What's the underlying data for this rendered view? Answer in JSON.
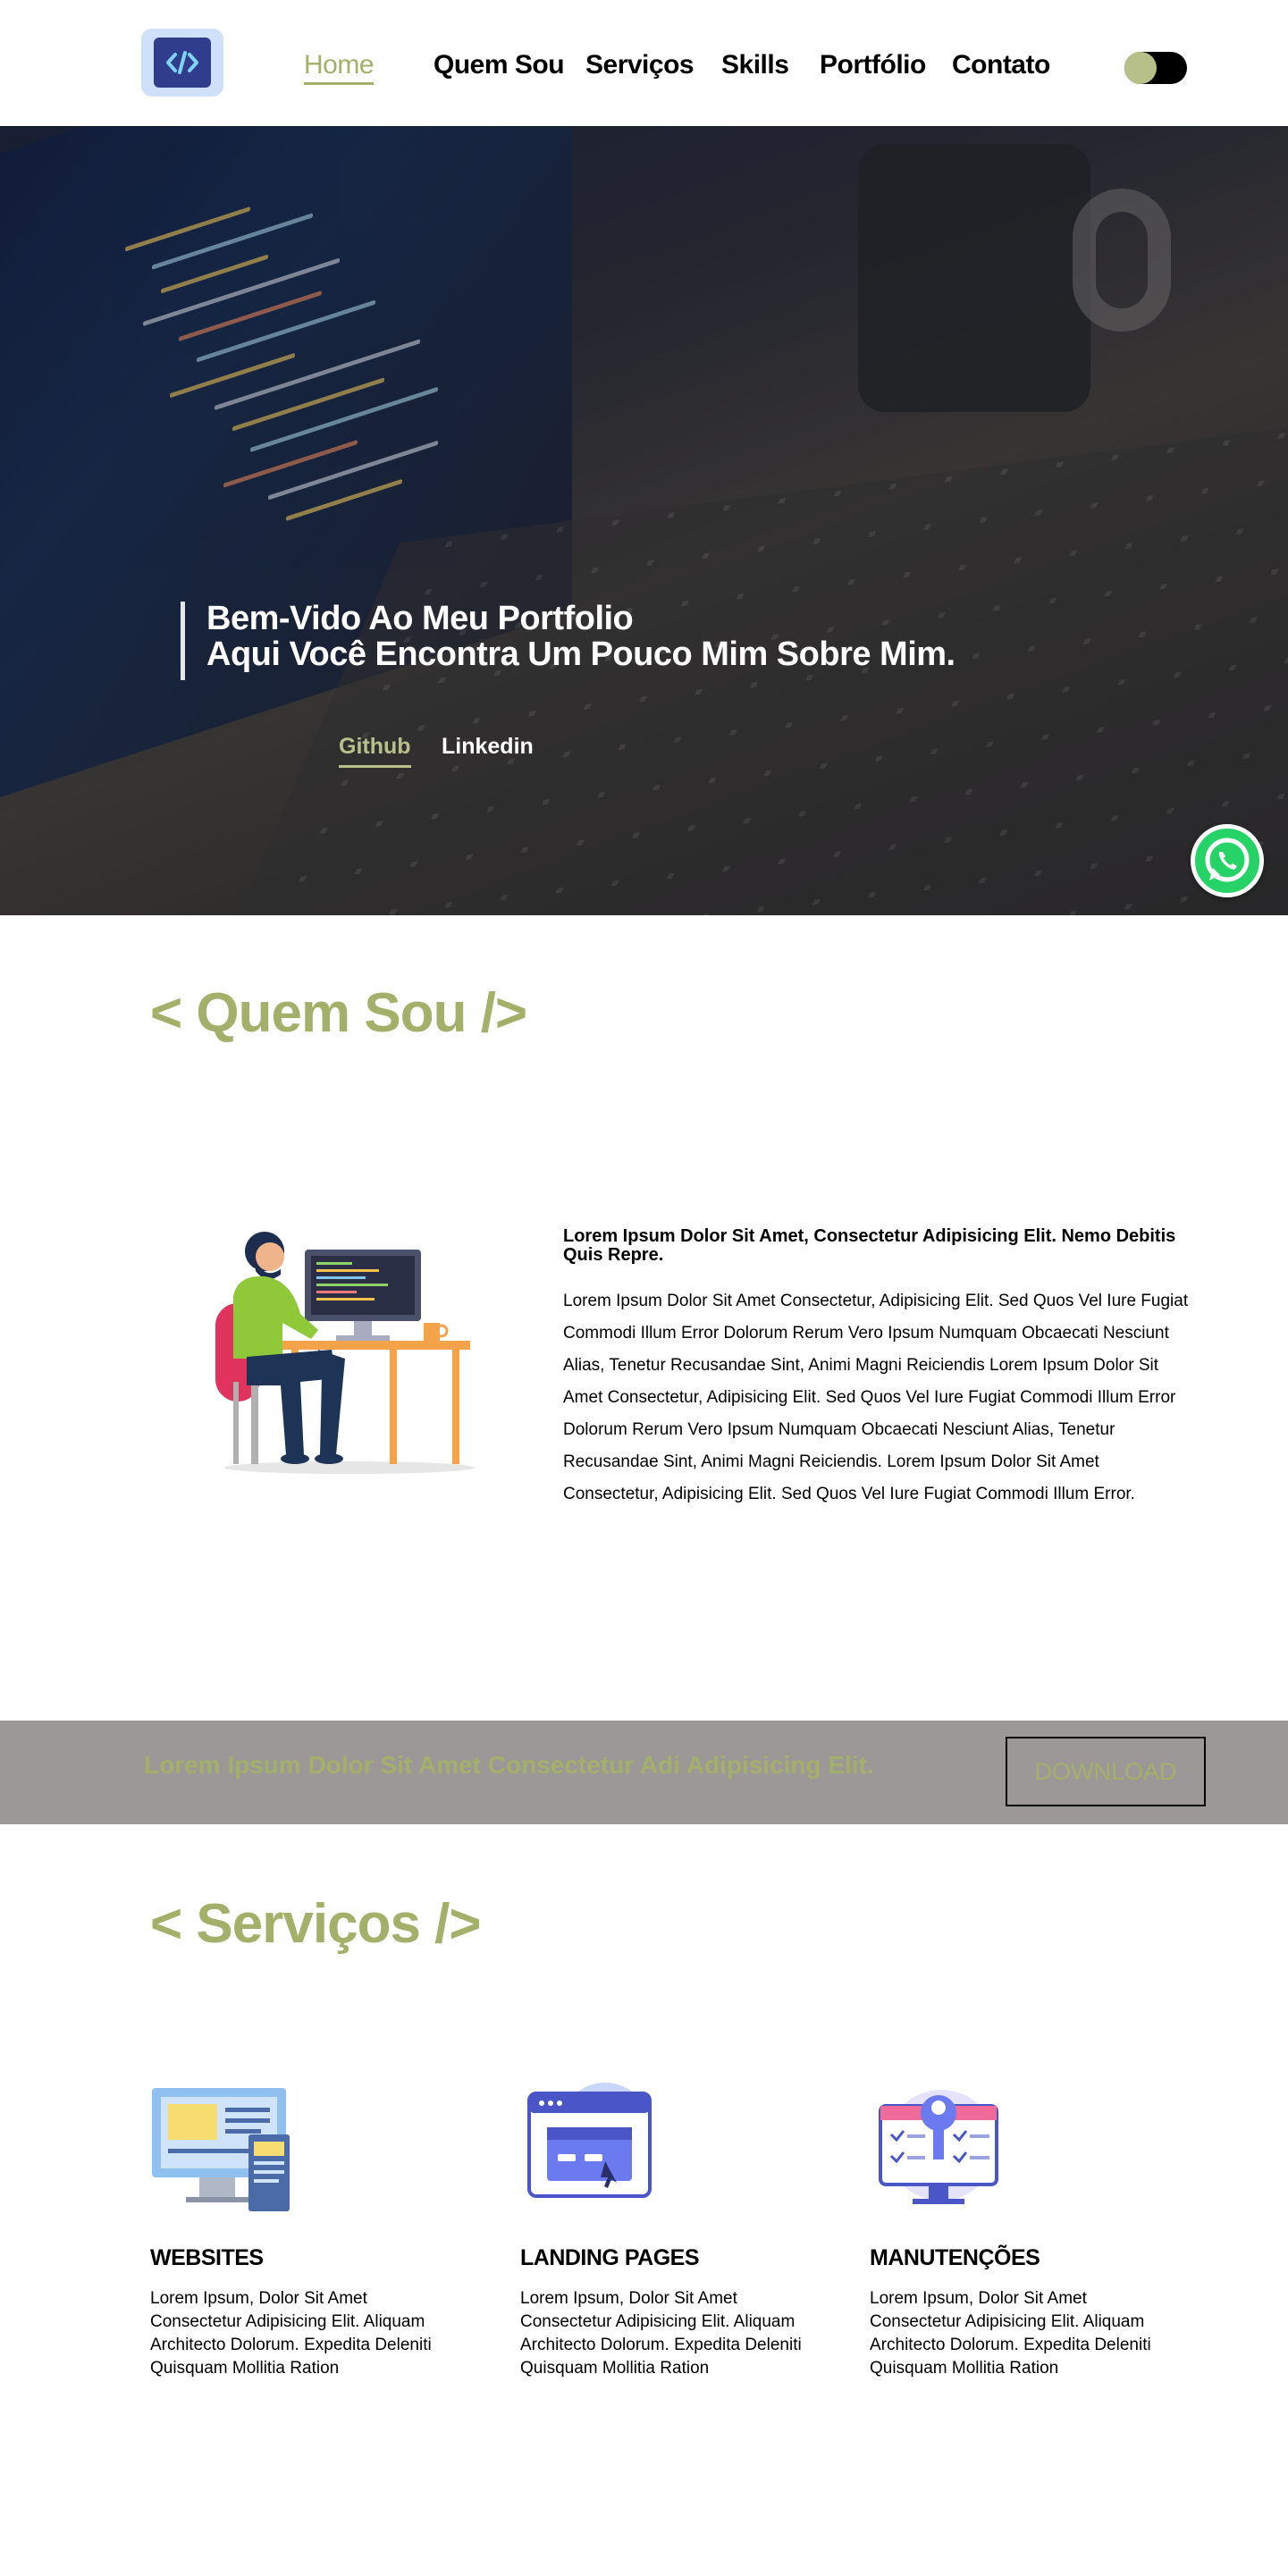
{
  "nav": {
    "links": [
      {
        "label": "Home",
        "active": true
      },
      {
        "label": "Quem Sou"
      },
      {
        "label": "Serviços"
      },
      {
        "label": "Skills"
      },
      {
        "label": "Portfólio"
      },
      {
        "label": "Contato"
      }
    ]
  },
  "hero": {
    "title_line1": "Bem-Vido Ao Meu Portfolio",
    "title_line2": "Aqui Você Encontra Um Pouco Mim Sobre Mim.",
    "links": [
      {
        "label": "Github",
        "active": true
      },
      {
        "label": "Linkedin"
      }
    ]
  },
  "about": {
    "title": "< Quem Sou />",
    "lead": "Lorem Ipsum Dolor Sit Amet, Consectetur Adipisicing Elit. Nemo Debitis Quis Repre.",
    "body": "Lorem Ipsum Dolor Sit Amet Consectetur, Adipisicing Elit. Sed Quos Vel Iure Fugiat Commodi Illum Error Dolorum Rerum Vero Ipsum Numquam Obcaecati Nesciunt Alias, Tenetur Recusandae Sint, Animi Magni Reiciendis Lorem Ipsum Dolor Sit Amet Consectetur, Adipisicing Elit. Sed Quos Vel Iure Fugiat Commodi Illum Error Dolorum Rerum Vero Ipsum Numquam Obcaecati Nesciunt Alias, Tenetur Recusandae Sint, Animi Magni Reiciendis. Lorem Ipsum Dolor Sit Amet Consectetur, Adipisicing Elit. Sed Quos Vel Iure Fugiat Commodi Illum Error."
  },
  "banner": {
    "text": "Lorem Ipsum Dolor Sit Amet Consectetur Adi Adipisicing Elit.",
    "button": "DOWNLOAD"
  },
  "services": {
    "title": "< Serviços />",
    "items": [
      {
        "title": "WEBSITES",
        "desc": "Lorem Ipsum, Dolor Sit Amet Consectetur Adipisicing Elit. Aliquam Architecto Dolorum. Expedita Deleniti Quisquam Mollitia Ration"
      },
      {
        "title": "LANDING PAGES",
        "desc": "Lorem Ipsum, Dolor Sit Amet Consectetur Adipisicing Elit. Aliquam Architecto Dolorum. Expedita Deleniti Quisquam Mollitia Ration"
      },
      {
        "title": "MANUTENÇÕES",
        "desc": "Lorem Ipsum, Dolor Sit Amet Consectetur Adipisicing Elit. Aliquam Architecto Dolorum. Expedita Deleniti Quisquam Mollitia Ration"
      }
    ]
  },
  "colors": {
    "accent": "#a3b06a",
    "banner_bg": "#9b9897",
    "logo_bg": "#cfe0fb",
    "logo_inner": "#2f3d8c",
    "whatsapp": "#25d366"
  },
  "icons": {
    "logo": "code-brackets-icon",
    "theme_toggle": "dark-mode-toggle",
    "whatsapp": "whatsapp-icon"
  }
}
